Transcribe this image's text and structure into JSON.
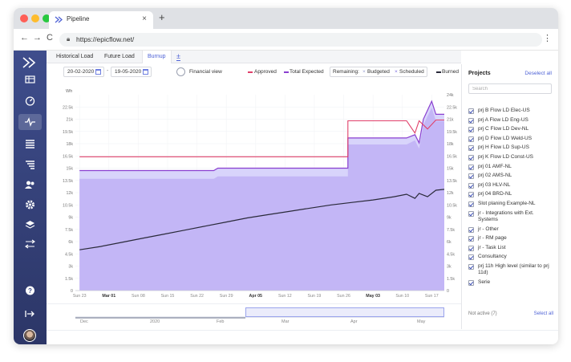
{
  "browser": {
    "tab_title": "Pipeline",
    "tab_close": "×",
    "new_tab": "+",
    "back": "←",
    "forward": "→",
    "reload": "C",
    "url": "https://epicflow.net/",
    "menu": "⋮",
    "traffic_lights": [
      "#ff5f57",
      "#febc2e",
      "#28c840"
    ]
  },
  "sidebar": {
    "items": [
      {
        "icon": "grid-icon"
      },
      {
        "icon": "dashboard-icon"
      },
      {
        "icon": "pulse-icon",
        "active": true
      },
      {
        "icon": "list-icon"
      },
      {
        "icon": "filter-list-icon"
      },
      {
        "icon": "users-icon"
      },
      {
        "icon": "gear-icon"
      },
      {
        "icon": "layers-icon"
      },
      {
        "icon": "transfer-icon"
      },
      {
        "icon": "help-icon"
      },
      {
        "icon": "logout-icon"
      }
    ]
  },
  "view_tabs": {
    "items": [
      "Historical Load",
      "Future Load",
      "Burnup"
    ],
    "active": "Burnup",
    "add_label": "±"
  },
  "toolbar": {
    "date_from": "20-02-2020",
    "date_to": "19-05-2020",
    "dash": "-",
    "financial_view": "Financial view",
    "legend": {
      "approved": "Approved",
      "total_expected": "Total Expected",
      "remaining": "Remaining:",
      "budgeted": "Budgeted",
      "scheduled": "Scheduled",
      "burned": "Burned"
    }
  },
  "colors": {
    "approved": "#e0406a",
    "total_expected": "#8a3fd0",
    "budgeted_fill": "#d8d4fb",
    "scheduled_fill": "#c3b6f6",
    "burned": "#2a2a3a",
    "accent": "#4f63d6",
    "sidebar": "#3a4785"
  },
  "chart_data": {
    "type": "area",
    "ylabel": "Wh",
    "yticks_left": [
      "22.5k",
      "21k",
      "19.5k",
      "18k",
      "16.5k",
      "15k",
      "13.5k",
      "12k",
      "10.5k",
      "9k",
      "7.5k",
      "6k",
      "4.5k",
      "3k",
      "1.5k",
      "0"
    ],
    "yticks_right": [
      "24k",
      "22.5k",
      "21k",
      "19.5k",
      "18k",
      "16.5k",
      "15k",
      "13.5k",
      "12k",
      "10.5k",
      "9k",
      "7.5k",
      "6k",
      "4.5k",
      "3k",
      "1.5k",
      "0"
    ],
    "xticks": [
      {
        "label": "Sun 23",
        "bold": false
      },
      {
        "label": "Mar 01",
        "bold": true
      },
      {
        "label": "Sun 08",
        "bold": false
      },
      {
        "label": "Sun 15",
        "bold": false
      },
      {
        "label": "Sun 22",
        "bold": false
      },
      {
        "label": "Sun 29",
        "bold": false
      },
      {
        "label": "Apr 05",
        "bold": true
      },
      {
        "label": "Sun 12",
        "bold": false
      },
      {
        "label": "Sun 19",
        "bold": false
      },
      {
        "label": "Sun 26",
        "bold": false
      },
      {
        "label": "May 03",
        "bold": true
      },
      {
        "label": "Sun 10",
        "bold": false
      },
      {
        "label": "Sun 17",
        "bold": false
      }
    ],
    "ylim": [
      0,
      24000
    ],
    "x_days_range": [
      -1,
      87
    ],
    "series": [
      {
        "name": "Approved",
        "points": [
          [
            0,
            16400
          ],
          [
            64,
            16400
          ],
          [
            64,
            20800
          ],
          [
            78,
            20800
          ],
          [
            80,
            19300
          ],
          [
            81,
            20800
          ],
          [
            83,
            19800
          ],
          [
            85,
            20900
          ],
          [
            87,
            20900
          ]
        ]
      },
      {
        "name": "Total Expected",
        "points": [
          [
            0,
            14700
          ],
          [
            32,
            14700
          ],
          [
            33,
            15000
          ],
          [
            64,
            15000
          ],
          [
            64,
            18700
          ],
          [
            78,
            18700
          ],
          [
            80,
            19100
          ],
          [
            81,
            18100
          ],
          [
            82,
            21000
          ],
          [
            84,
            23200
          ],
          [
            85,
            21600
          ],
          [
            87,
            21600
          ]
        ]
      },
      {
        "name": "Budgeted",
        "points": [
          [
            0,
            14700
          ],
          [
            32,
            14700
          ],
          [
            33,
            15000
          ],
          [
            64,
            15000
          ],
          [
            64,
            18700
          ],
          [
            78,
            18700
          ],
          [
            80,
            19100
          ],
          [
            81,
            18100
          ],
          [
            82,
            21000
          ],
          [
            84,
            23200
          ],
          [
            85,
            21600
          ],
          [
            87,
            21600
          ]
        ]
      },
      {
        "name": "Scheduled",
        "points": [
          [
            0,
            13700
          ],
          [
            32,
            13700
          ],
          [
            33,
            14000
          ],
          [
            64,
            14000
          ],
          [
            64,
            17900
          ],
          [
            78,
            17900
          ],
          [
            80,
            18400
          ],
          [
            81,
            17400
          ],
          [
            82,
            20300
          ],
          [
            84,
            22400
          ],
          [
            85,
            20800
          ],
          [
            87,
            20800
          ]
        ]
      },
      {
        "name": "Burned",
        "points": [
          [
            0,
            5000
          ],
          [
            5,
            5400
          ],
          [
            10,
            5900
          ],
          [
            15,
            6400
          ],
          [
            20,
            6900
          ],
          [
            25,
            7400
          ],
          [
            30,
            7900
          ],
          [
            35,
            8400
          ],
          [
            40,
            8900
          ],
          [
            45,
            9300
          ],
          [
            50,
            9700
          ],
          [
            55,
            10100
          ],
          [
            60,
            10500
          ],
          [
            65,
            10800
          ],
          [
            70,
            11100
          ],
          [
            75,
            11500
          ],
          [
            78,
            11800
          ],
          [
            80,
            11300
          ],
          [
            81,
            11900
          ],
          [
            83,
            11500
          ],
          [
            85,
            12300
          ],
          [
            87,
            12400
          ]
        ]
      }
    ],
    "grid": true,
    "legend_position": "top"
  },
  "navigator": {
    "labels": [
      "Dec",
      "2020",
      "Feb",
      "Mar",
      "Apr",
      "May"
    ]
  },
  "projects": {
    "title": "Projects",
    "deselect_all": "Deselect all",
    "search_placeholder": "Search",
    "items": [
      "prj B Flow LD Elec-US",
      "prj A Flow LD Eng-US",
      "prj C Flow LD Dev-NL",
      "prj D Flow LD Weld-US",
      "prj H Flow LD Sup-US",
      "prj K Flow LD Const-US",
      "prj 01 AMF-NL",
      "prj 02 AMS-NL",
      "prj 03 HLV-NL",
      "prj 04 BRD-NL",
      "Slot planing Example-NL",
      "jr - Integrations with Ext. Systems",
      "jr - Other",
      "jr - RM page",
      "jr - Task List",
      "Consultancy",
      "prj 11h High level (similar to prj 11d)",
      "Serie"
    ],
    "not_active": "Not active (7)",
    "select_all": "Select all"
  }
}
